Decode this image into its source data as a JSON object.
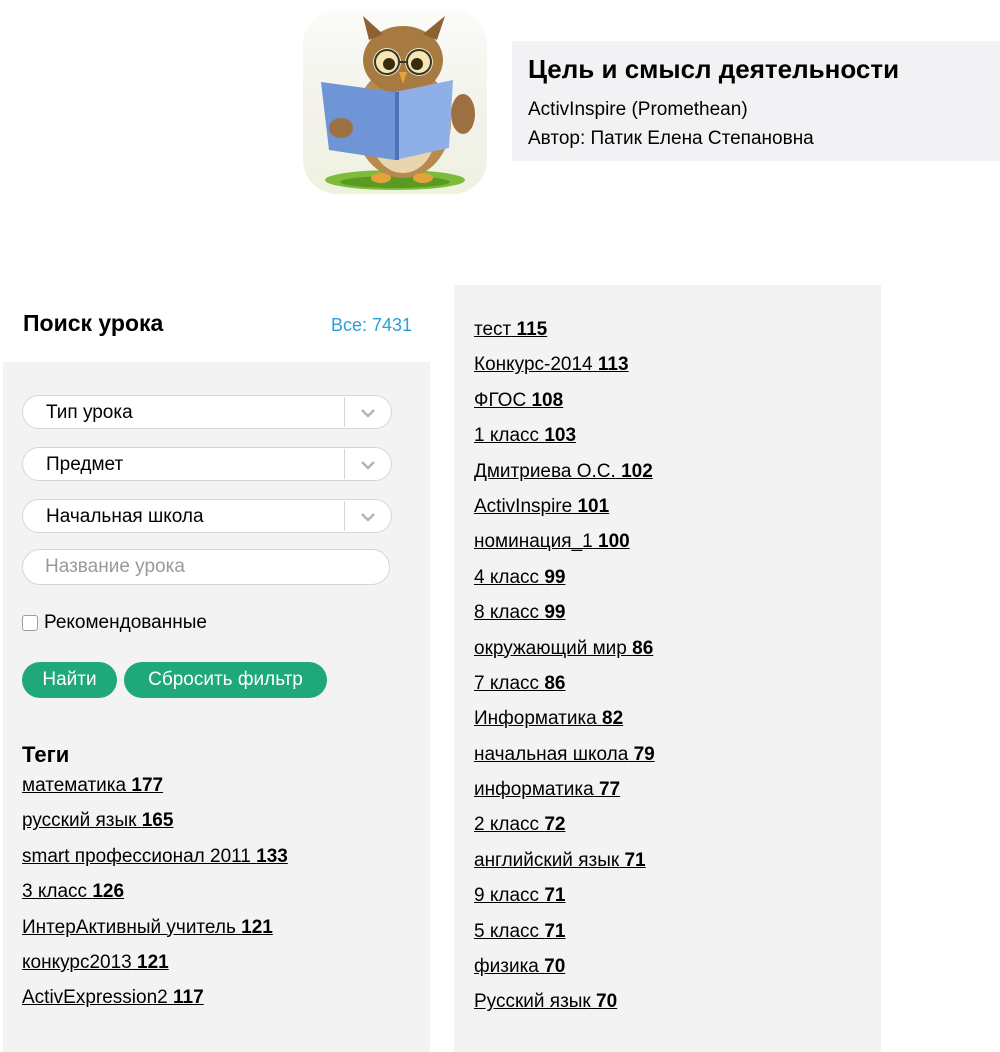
{
  "lesson": {
    "title": "Цель и смысл деятельности",
    "software": "ActivInspire (Promethean)",
    "author": "Автор: Патик Елена Степановна"
  },
  "search": {
    "title": "Поиск урока",
    "all_count": "Все: 7431",
    "selects": [
      {
        "value": "Тип урока"
      },
      {
        "value": "Предмет"
      },
      {
        "value": "Начальная школа"
      }
    ],
    "name_placeholder": "Название урока",
    "recommended_label": "Рекомендованные",
    "find_label": "Найти",
    "reset_label": "Сбросить фильтр"
  },
  "tags": {
    "title": "Теги",
    "left": [
      {
        "name": "математика",
        "count": "177"
      },
      {
        "name": "русский язык",
        "count": "165"
      },
      {
        "name": "smart профессионал 2011",
        "count": "133"
      },
      {
        "name": "3 класс",
        "count": "126"
      },
      {
        "name": "ИнтерАктивный учитель",
        "count": "121"
      },
      {
        "name": "конкурс2013",
        "count": "121"
      },
      {
        "name": "ActivExpression2",
        "count": "117"
      }
    ],
    "right": [
      {
        "name": "тест",
        "count": "115"
      },
      {
        "name": "Конкурс-2014",
        "count": "113"
      },
      {
        "name": "ФГОС",
        "count": "108"
      },
      {
        "name": "1 класс",
        "count": "103"
      },
      {
        "name": "Дмитриева О.С.",
        "count": "102"
      },
      {
        "name": "ActivInspire",
        "count": "101"
      },
      {
        "name": "номинация_1",
        "count": "100"
      },
      {
        "name": "4 класс",
        "count": "99"
      },
      {
        "name": "8 класс",
        "count": "99"
      },
      {
        "name": "окружающий мир",
        "count": "86"
      },
      {
        "name": "7 класс",
        "count": "86"
      },
      {
        "name": "Информатика",
        "count": "82"
      },
      {
        "name": "начальная школа",
        "count": "79"
      },
      {
        "name": "информатика",
        "count": "77"
      },
      {
        "name": "2 класс",
        "count": "72"
      },
      {
        "name": "английский язык",
        "count": "71"
      },
      {
        "name": "9 класс",
        "count": "71"
      },
      {
        "name": "5 класс",
        "count": "71"
      },
      {
        "name": "физика",
        "count": "70"
      },
      {
        "name": "Русский язык",
        "count": "70"
      }
    ]
  }
}
